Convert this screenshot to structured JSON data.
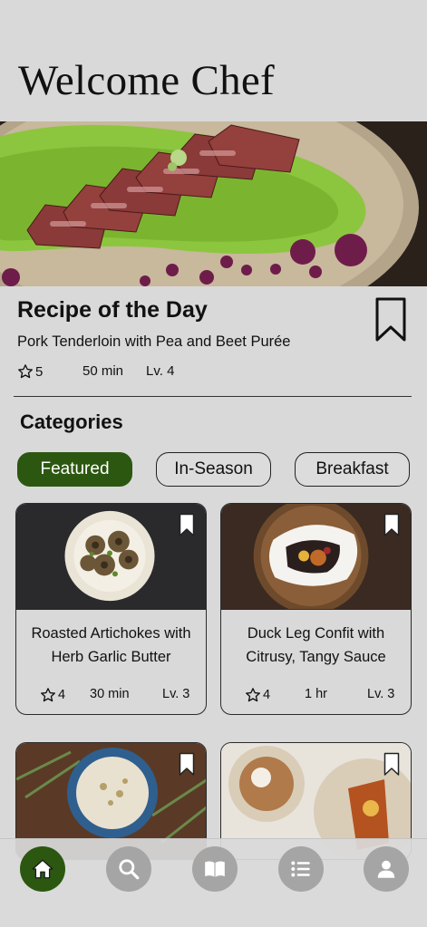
{
  "header": {
    "title": "Welcome Chef"
  },
  "recipe_of_day": {
    "heading": "Recipe of the Day",
    "name": "Pork Tenderloin with Pea and Beet Purée",
    "rating": "5",
    "time": "50 min",
    "level": "Lv. 4"
  },
  "categories": {
    "heading": "Categories",
    "chips": [
      {
        "label": "Featured",
        "active": true
      },
      {
        "label": "In-Season",
        "active": false
      },
      {
        "label": "Breakfast",
        "active": false
      }
    ]
  },
  "recipes": [
    {
      "name_line1": "Roasted Artichokes with",
      "name_line2": "Herb Garlic Butter",
      "rating": "4",
      "time": "30 min",
      "level": "Lv. 3"
    },
    {
      "name_line1": "Duck Leg Confit with",
      "name_line2": "Citrusy, Tangy Sauce",
      "rating": "4",
      "time": "1 hr",
      "level": "Lv. 3"
    }
  ],
  "tabbar": {
    "items": [
      "home-icon",
      "search-icon",
      "book-icon",
      "list-icon",
      "profile-icon"
    ],
    "active": "home-icon"
  },
  "colors": {
    "accent": "#2c5710",
    "background": "#d9d9d9",
    "inactive_tab": "#a5a5a5"
  }
}
